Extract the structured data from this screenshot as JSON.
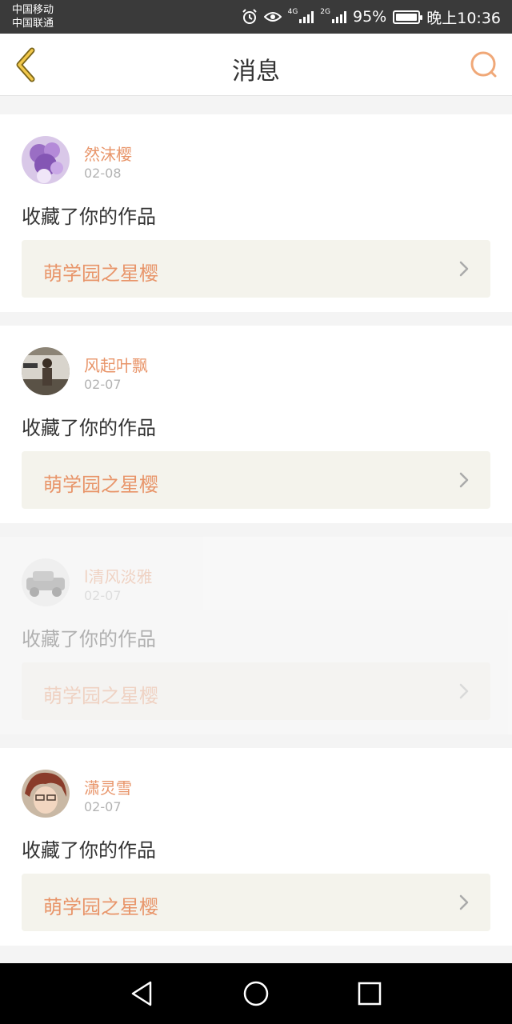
{
  "status_bar": {
    "carrier1": "中国移动",
    "carrier2": "中国联通",
    "net1": "4G",
    "net2": "2G",
    "battery": "95%",
    "time": "晚上10:36"
  },
  "header": {
    "title": "消息",
    "accent_color": "#e8956a"
  },
  "messages": [
    {
      "name": "然沫樱",
      "date": "02-08",
      "action": "收藏了你的作品",
      "work": "萌学园之星樱"
    },
    {
      "name": "风起叶飘",
      "date": "02-07",
      "action": "收藏了你的作品",
      "work": "萌学园之星樱"
    },
    {
      "name": "l清风淡雅",
      "date": "02-07",
      "action": "收藏了你的作品",
      "work": "萌学园之星樱"
    },
    {
      "name": "潇灵雪",
      "date": "02-07",
      "action": "收藏了你的作品",
      "work": "萌学园之星樱"
    }
  ]
}
